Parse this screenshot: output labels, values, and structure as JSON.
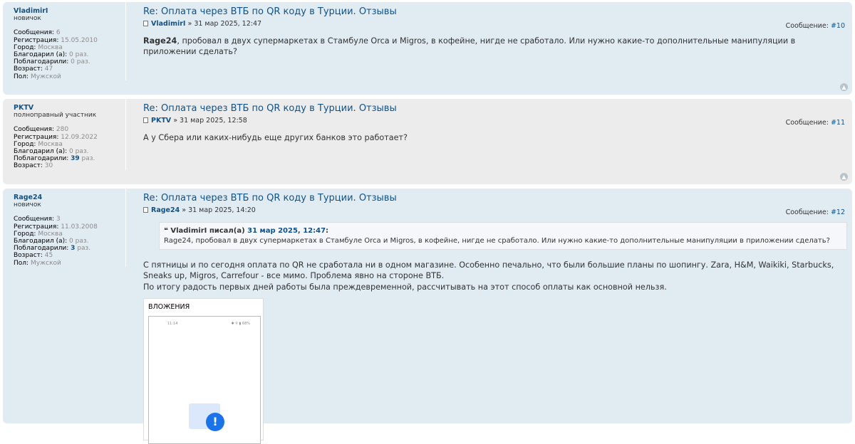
{
  "posts": [
    {
      "username": "VladimirI",
      "rank": "новичок",
      "profile": [
        {
          "label": "Сообщения:",
          "value": "6"
        },
        {
          "label": "Регистрация:",
          "value": "15.05.2010"
        },
        {
          "label": "Город:",
          "value": "Москва"
        },
        {
          "label": "Благодарил (а):",
          "value": "0 раз."
        },
        {
          "label": "Поблагодарили:",
          "value": "0 раз."
        },
        {
          "label": "Возраст:",
          "value": "47"
        },
        {
          "label": "Пол:",
          "value": "Мужской"
        }
      ],
      "title": "Re: Оплата через ВТБ по QR коду в Турции. Отзывы",
      "author": "VladimirI",
      "date": "» 31 мар 2025, 12:47",
      "post_label": "Сообщение:",
      "post_number": "#10",
      "mention": "Rage24",
      "body": ", пробовал в двух супермаркетах в Стамбуле Orca и Migros, в кофейне, нигде не сработало. Или нужно какие-то дополнительные манипуляции в приложении сделать?"
    },
    {
      "username": "PKTV",
      "rank": "полноправный участник",
      "profile": [
        {
          "label": "Сообщения:",
          "value": "280"
        },
        {
          "label": "Регистрация:",
          "value": "12.09.2022"
        },
        {
          "label": "Город:",
          "value": "Москва"
        },
        {
          "label": "Благодарил (а):",
          "value": "0 раз."
        },
        {
          "label": "Поблагодарили:",
          "value_strong": "39",
          "value": "раз."
        },
        {
          "label": "Возраст:",
          "value": "30"
        }
      ],
      "title": "Re: Оплата через ВТБ по QR коду в Турции. Отзывы",
      "author": "PKTV",
      "date": "» 31 мар 2025, 12:58",
      "post_label": "Сообщение:",
      "post_number": "#11",
      "body": "А у Сбера или каких-нибудь еще других банков это работает?"
    },
    {
      "username": "Rage24",
      "rank": "новичок",
      "profile": [
        {
          "label": "Сообщения:",
          "value": "3"
        },
        {
          "label": "Регистрация:",
          "value": "11.03.2008"
        },
        {
          "label": "Город:",
          "value": "Москва"
        },
        {
          "label": "Благодарил (а):",
          "value": "0 раз."
        },
        {
          "label": "Поблагодарили:",
          "value_strong": "3",
          "value": "раз."
        },
        {
          "label": "Возраст:",
          "value": "45"
        },
        {
          "label": "Пол:",
          "value": "Мужской"
        }
      ],
      "title": "Re: Оплата через ВТБ по QR коду в Турции. Отзывы",
      "author": "Rage24",
      "date": "» 31 мар 2025, 14:20",
      "post_label": "Сообщение:",
      "post_number": "#12",
      "quote": {
        "quote_mark": "❝",
        "author": "VladimirI писал(а)",
        "date": "31 мар 2025, 12:47",
        "colon": ":",
        "text": "Rage24, пробовал в двух супермаркетах в Стамбуле Orca и Migros, в кофейне, нигде не сработало. Или нужно какие-то дополнительные манипуляции в приложении сделать?"
      },
      "body_lines": [
        "С пятницы и по сегодня оплата по QR не сработала ни в одном магазине. Особенно печально, что были большие планы по шопингу. Zara, H&M, Waikiki, Starbucks, Sneaks up, Migros, Carrefour - все мимо. Проблема явно на стороне ВТБ.",
        "По итогу радость первых дней работы была преждевременной, рассчитывать на этот способ оплаты как основной нельзя."
      ],
      "attachments_label": "ВЛОЖЕНИЯ",
      "phone_time": "11:14",
      "phone_status": "✱ ⚲ ▮ 68%",
      "alert_glyph": "!"
    }
  ],
  "up_icon": "▲",
  "colors": {
    "link": "#105289",
    "post_blue": "#e1ebf2",
    "post_gray": "#ececec"
  }
}
